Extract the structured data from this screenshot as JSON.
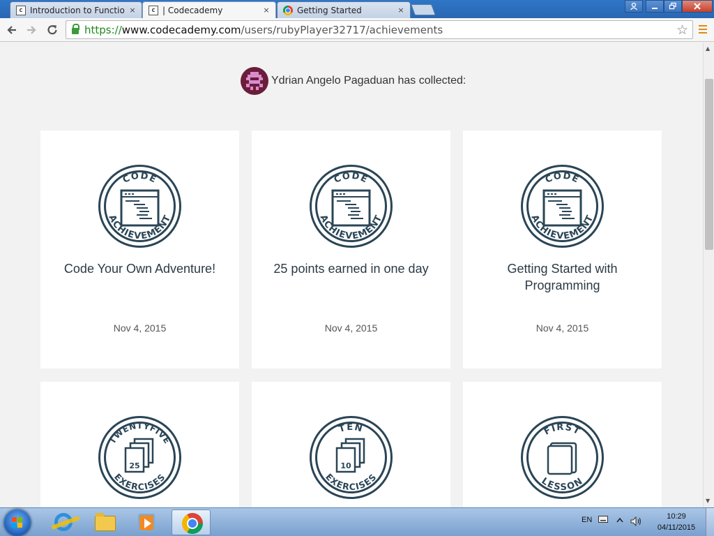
{
  "browser": {
    "tabs": [
      {
        "title": "Introduction to Functions",
        "icon": "codecademy-icon",
        "active": false
      },
      {
        "title": "| Codecademy",
        "icon": "codecademy-icon",
        "active": true
      },
      {
        "title": "Getting Started",
        "icon": "chrome-icon",
        "active": false
      }
    ],
    "tab_close_glyph": "×",
    "url_scheme": "https://",
    "url_host": "www.codecademy.com",
    "url_path": "/users/rubyPlayer32717/achievements"
  },
  "page": {
    "user_name": "Ydrian Angelo Pagaduan",
    "collected_suffix": " has collected:",
    "achievements": [
      {
        "title": "Code Your Own Adventure!",
        "date": "Nov 4, 2015",
        "badge": "code-achievement",
        "top": "CODE",
        "bottom": "ACHIEVEMENT"
      },
      {
        "title": "25 points earned in one day",
        "date": "Nov 4, 2015",
        "badge": "code-achievement",
        "top": "CODE",
        "bottom": "ACHIEVEMENT"
      },
      {
        "title": "Getting Started with Programming",
        "date": "Nov 4, 2015",
        "badge": "code-achievement",
        "top": "CODE",
        "bottom": "ACHIEVEMENT"
      },
      {
        "title": "",
        "date": "",
        "badge": "exercises",
        "top": "TWENTYFIVE",
        "bottom": "EXERCISES",
        "number": "25"
      },
      {
        "title": "",
        "date": "",
        "badge": "exercises",
        "top": "TEN",
        "bottom": "EXERCISES",
        "number": "10"
      },
      {
        "title": "",
        "date": "",
        "badge": "lesson",
        "top": "FIRST",
        "bottom": "LESSON"
      }
    ]
  },
  "taskbar": {
    "language": "EN",
    "time": "10:29",
    "date": "04/11/2015"
  },
  "colors": {
    "badge": "#2a4556",
    "accent": "#e08a10",
    "avatar": "#6b1d3a"
  }
}
